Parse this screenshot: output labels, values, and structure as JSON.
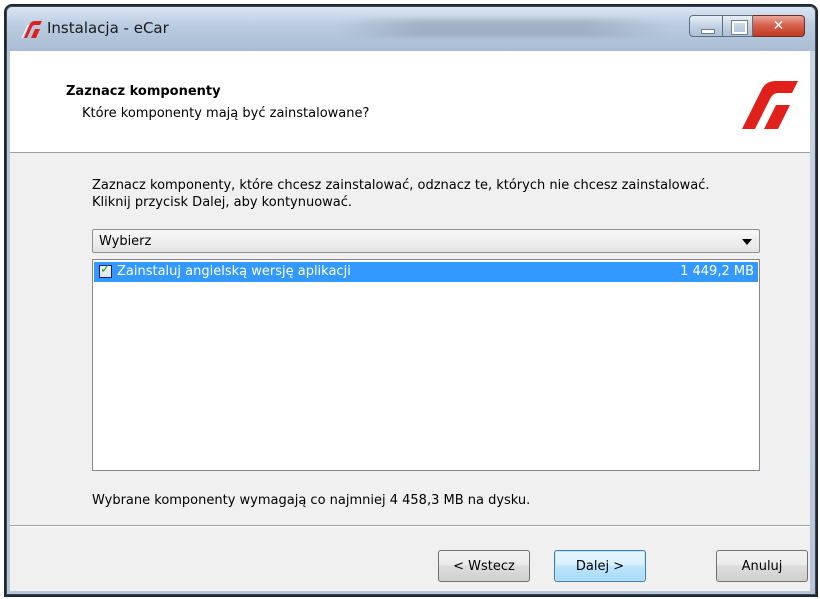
{
  "window": {
    "title": "Instalacja - eCar"
  },
  "header": {
    "title": "Zaznacz komponenty",
    "subtitle": "Które komponenty mają być zainstalowane?"
  },
  "instructions": {
    "line1": "Zaznacz komponenty, które chcesz zainstalować, odznacz te, których nie chcesz zainstalować.",
    "line2": "Kliknij przycisk Dalej, aby kontynuować."
  },
  "combo": {
    "value": "Wybierz"
  },
  "components": [
    {
      "label": "Zainstaluj angielską wersję aplikacji",
      "size": "1 449,2 MB",
      "checked": true,
      "selected": true
    }
  ],
  "disk_requirement": "Wybrane komponenty wymagają co najmniej 4 458,3 MB na dysku.",
  "buttons": {
    "back": "< Wstecz",
    "next": "Dalej >",
    "cancel": "Anuluj"
  },
  "colors": {
    "selection": "#3399ff",
    "logo": "#e0201b",
    "close_button": "#c23a22"
  },
  "icons": {
    "app": "ecar-logo-icon",
    "minimize": "minimize-icon",
    "maximize": "maximize-icon",
    "close": "close-icon",
    "dropdown": "chevron-down-icon",
    "checkbox": "checkmark-icon"
  }
}
